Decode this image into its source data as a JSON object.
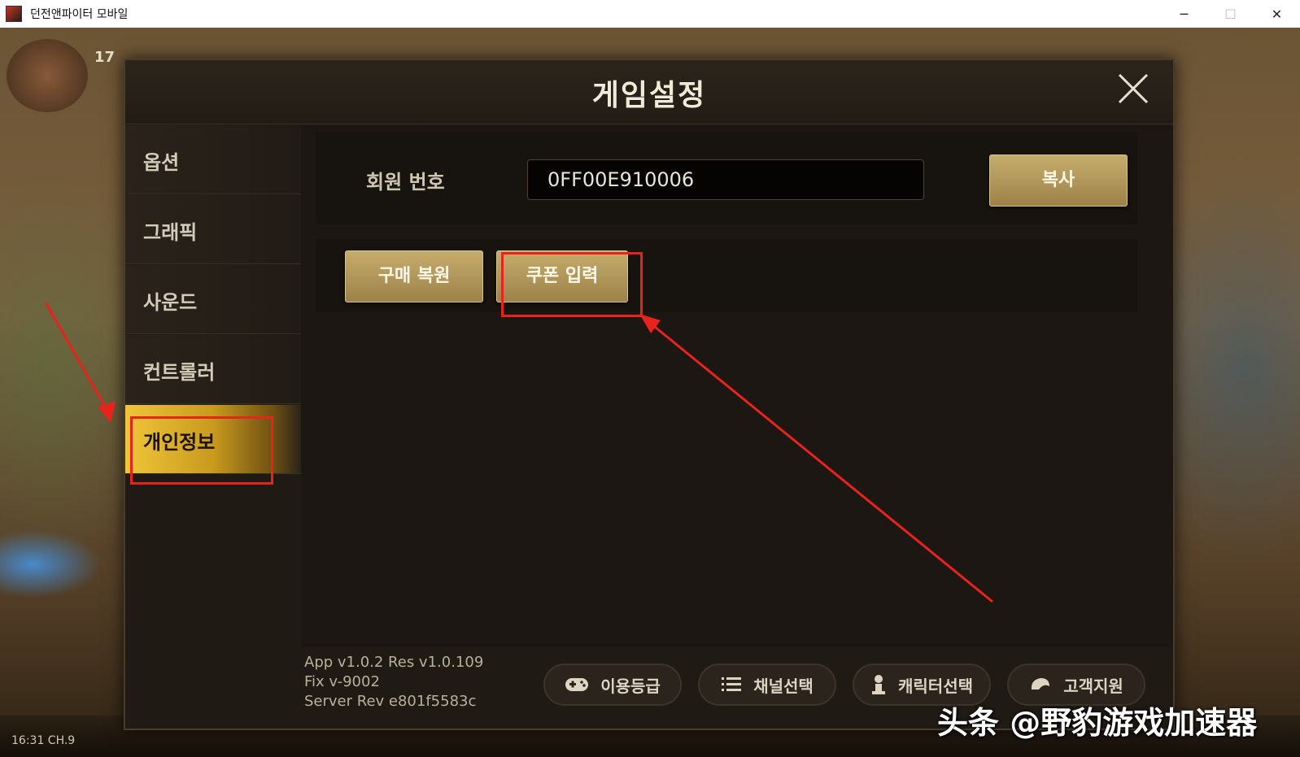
{
  "window": {
    "title": "던전앤파이터 모바일",
    "controls": [
      "─",
      "☐",
      "✕"
    ]
  },
  "hud": {
    "level": "17",
    "time": "16:31  CH.9"
  },
  "dialog": {
    "title": "게임설정",
    "close_icon": "close-icon",
    "sidebar": {
      "items": [
        {
          "label": "옵션"
        },
        {
          "label": "그래픽"
        },
        {
          "label": "사운드"
        },
        {
          "label": "컨트롤러"
        },
        {
          "label": "개인정보",
          "active": true
        }
      ]
    },
    "member": {
      "label": "회원 번호",
      "value": "0FF00E910006",
      "copy_label": "복사"
    },
    "actions": {
      "restore_label": "구매 복원",
      "coupon_label": "쿠폰 입력"
    },
    "footer": {
      "version_lines": [
        "App v1.0.2 Res v1.0.109",
        "Fix v-9002",
        "Server Rev e801f5583c"
      ],
      "buttons": [
        {
          "label": "이용등급",
          "icon": "gamepad-icon"
        },
        {
          "label": "채널선택",
          "icon": "list-icon"
        },
        {
          "label": "캐릭터선택",
          "icon": "character-icon"
        },
        {
          "label": "고객지원",
          "icon": "support-icon"
        }
      ]
    }
  },
  "annotation_color": "#e8231c",
  "watermark": "头条 @野豹游戏加速器"
}
